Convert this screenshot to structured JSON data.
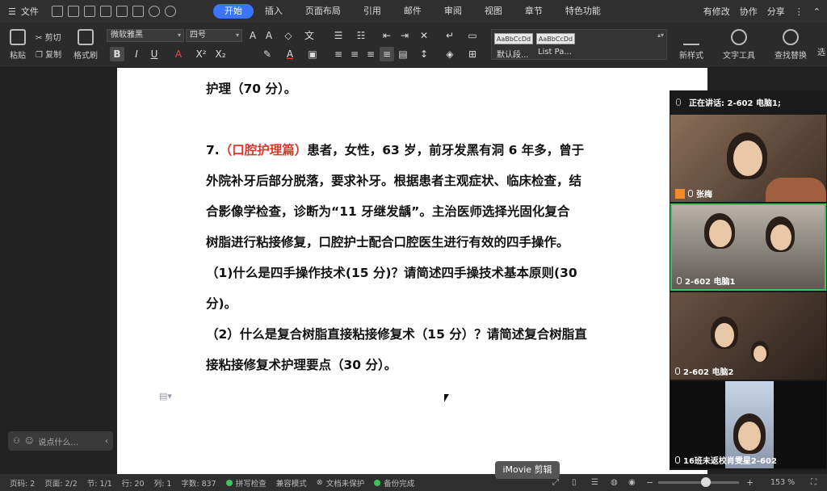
{
  "menubar": {
    "file_label": "文件",
    "tabs": [
      "开始",
      "插入",
      "页面布局",
      "引用",
      "邮件",
      "审阅",
      "视图",
      "章节",
      "特色功能"
    ],
    "right_items": [
      "有修改",
      "协作",
      "分享"
    ]
  },
  "ribbon": {
    "paste": "粘贴",
    "cut": "剪切",
    "copy": "复制",
    "format_painter": "格式刷",
    "font_name": "微软雅黑",
    "font_size": "四号",
    "style_samples": [
      "AaBbCcDd",
      "AaBbCcDd"
    ],
    "style_names": [
      "默认段...",
      "List Pa..."
    ],
    "new_style": "新样式",
    "text_tools": "文字工具",
    "find_replace": "查找替换",
    "more": "选"
  },
  "document": {
    "line0": "护理（70 分）。",
    "q7_num": "7.",
    "q7_tag": "（口腔护理篇）",
    "q7_line1": "患者，女性，63 岁，前牙发黑有洞 6 年多，曾于",
    "q7_line2": "外院补牙后部分脱落，要求补牙。根据患者主观症状、临床检查，结",
    "q7_line3": "合影像学检查，诊断为“11  牙继发龋”。主治医师选择光固化复合",
    "q7_line4": "树脂进行粘接修复，口腔护士配合口腔医生进行有效的四手操作。",
    "q7_line5": "（1)什么是四手操作技术(15 分)？请简述四手操技术基本原则(30",
    "q7_line6": "分)。",
    "q7_line7": "（2）什么是复合树脂直接粘接修复术（15 分）？请简述复合树脂直",
    "q7_line8": "接粘接修复术护理要点（30 分）。"
  },
  "left_float": {
    "placeholder": "说点什么..."
  },
  "meeting": {
    "speaking": "正在讲话: 2-602 电脑1;",
    "participants": [
      "张梅",
      "2-602 电脑1",
      "2-602 电脑2",
      "16班未返校肖雯星2-602"
    ]
  },
  "statusbar": {
    "page_code": "页码: 2",
    "pages": "页面: 2/2",
    "section": "节: 1/1",
    "row": "行: 20",
    "col": "列: 1",
    "words": "字数: 837",
    "spell": "拼写检查",
    "compat": "兼容模式",
    "protect": "文档未保护",
    "backup": "备份完成",
    "zoom": "153 %"
  },
  "tooltip": "iMovie 剪辑",
  "colors": {
    "accent": "#3a74ff",
    "tag_red": "#d93a2b",
    "active_green": "#3ec35f"
  }
}
